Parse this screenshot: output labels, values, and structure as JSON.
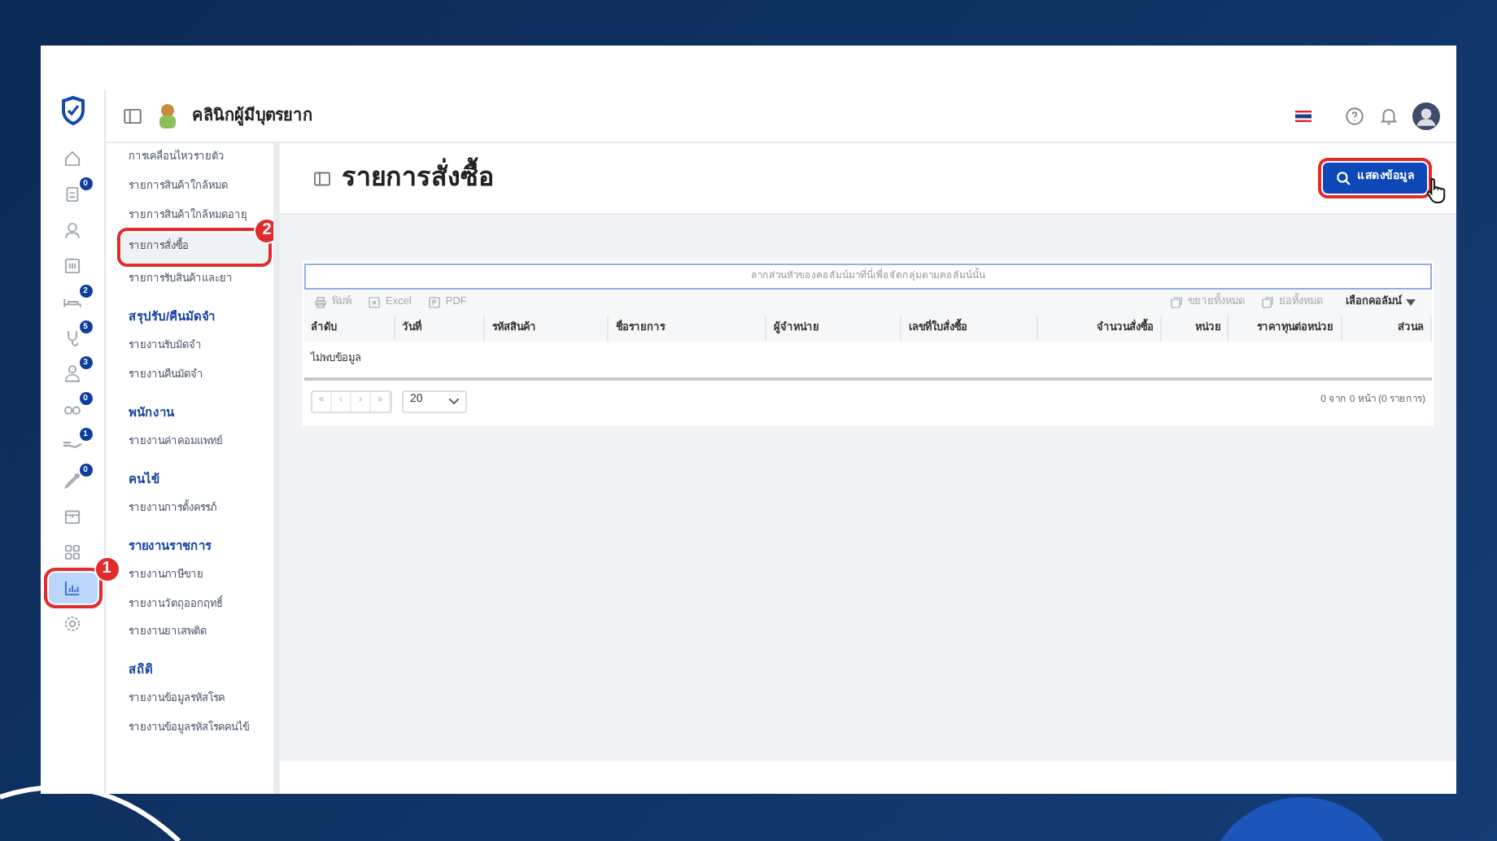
{
  "header": {
    "clinic_name": "คลินิกผู้มีบุตรยาก"
  },
  "rail": [
    {
      "selected": false
    },
    {
      "badge": "0",
      "selected": false
    },
    {
      "selected": false
    },
    {
      "selected": false
    },
    {
      "badge": "2",
      "selected": false
    },
    {
      "badge": "5",
      "selected": false
    },
    {
      "badge": "3",
      "selected": false
    },
    {
      "badge": "0",
      "selected": false
    },
    {
      "badge": "1",
      "selected": false
    },
    {
      "badge": "0",
      "selected": false
    },
    {
      "selected": false
    },
    {
      "selected": false
    },
    {
      "selected": true,
      "callout": "1"
    },
    {
      "selected": false
    }
  ],
  "submenu": [
    {
      "kind": "item",
      "label": "การเคลื่อนไหวรายตัว",
      "selected": false
    },
    {
      "kind": "item",
      "label": "รายการสินค้าใกล้หมด",
      "selected": false
    },
    {
      "kind": "item",
      "label": "รายการสินค้าใกล้หมดอายุ",
      "selected": false
    },
    {
      "kind": "item",
      "label": "รายการสั่งซื้อ",
      "selected": true,
      "callout": "2"
    },
    {
      "kind": "item",
      "label": "รายการรับสินค้าและยา",
      "selected": false
    },
    {
      "kind": "section",
      "label": "สรุปรับ/คืนมัดจำ"
    },
    {
      "kind": "item",
      "label": "รายงานรับมัดจำ",
      "selected": false
    },
    {
      "kind": "item",
      "label": "รายงานคืนมัดจำ",
      "selected": false
    },
    {
      "kind": "section",
      "label": "พนักงาน"
    },
    {
      "kind": "item",
      "label": "รายงานค่าคอมแพทย์",
      "selected": false
    },
    {
      "kind": "section",
      "label": "คนไข้"
    },
    {
      "kind": "item",
      "label": "รายงานการตั้งครรภ์",
      "selected": false
    },
    {
      "kind": "section",
      "label": "รายงานราชการ"
    },
    {
      "kind": "item",
      "label": "รายงานภาษีขาย",
      "selected": false
    },
    {
      "kind": "item",
      "label": "รายงานวัตถุออกฤทธิ์",
      "selected": false
    },
    {
      "kind": "item",
      "label": "รายงานยาเสพติด",
      "selected": false
    },
    {
      "kind": "section",
      "label": "สถิติ"
    },
    {
      "kind": "item",
      "label": "รายงานข้อมูลรหัสโรค",
      "selected": false
    },
    {
      "kind": "item",
      "label": "รายงานข้อมูลรหัสโรคคนไข้",
      "selected": false
    }
  ],
  "page": {
    "title": "รายการสั่งซื้อ",
    "show_button": "แสดงข้อมูล"
  },
  "grid": {
    "group_panel": "ลากส่วนหัวของคอลัมน์มาที่นี่เพื่อจัดกลุ่มตามคอลัมน์นั้น",
    "toolbar_left": [
      {
        "label": "พิมพ์",
        "disabled": true
      },
      {
        "label": "Excel",
        "disabled": true
      },
      {
        "label": "PDF",
        "disabled": true
      }
    ],
    "toolbar_right": [
      {
        "label": "ขยายทั้งหมด",
        "disabled": true
      },
      {
        "label": "ย่อทั้งหมด",
        "disabled": true
      }
    ],
    "column_chooser": "เลือกคอลัมน์",
    "columns": [
      {
        "label": "ลำดับ"
      },
      {
        "label": "วันที่"
      },
      {
        "label": "รหัสสินค้า"
      },
      {
        "label": "ชื่อรายการ"
      },
      {
        "label": "ผู้จำหน่าย"
      },
      {
        "label": "เลขที่ใบสั่งซื้อ"
      },
      {
        "label": "จำนวนสั่งซื้อ"
      },
      {
        "label": "หน่วย"
      },
      {
        "label": "ราคาทุนต่อหน่วย"
      },
      {
        "label": "ส่วนล"
      }
    ],
    "empty_text": "ไม่พบข้อมูล",
    "pager_buttons": [
      "«",
      "‹",
      "›",
      "»"
    ],
    "page_size": "20",
    "page_info": "0 จาก 0 หน้า (0 รายการ)"
  }
}
